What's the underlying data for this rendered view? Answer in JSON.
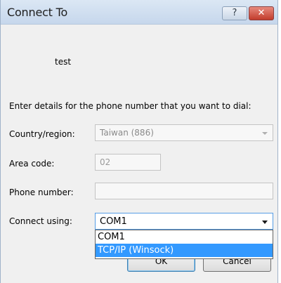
{
  "window": {
    "title": "Connect To",
    "help_label": "?",
    "close_label": "✕"
  },
  "connection": {
    "name": "test"
  },
  "instruction": "Enter details for the phone number that you want to dial:",
  "fields": {
    "country": {
      "label": "Country/region:",
      "value": "Taiwan (886)"
    },
    "area_code": {
      "label": "Area code:",
      "value": "02"
    },
    "phone_number": {
      "label": "Phone number:",
      "value": ""
    },
    "connect_using": {
      "label": "Connect using:",
      "value": "COM1",
      "options": [
        "COM1",
        "TCP/IP (Winsock)"
      ],
      "highlighted_option": "TCP/IP (Winsock)"
    }
  },
  "buttons": {
    "ok": "OK",
    "cancel": "Cancel"
  },
  "colors": {
    "titlebar": "#c6d7ec",
    "close_button": "#c23c2c",
    "selection": "#3399ff",
    "focus_border": "#569de5"
  }
}
